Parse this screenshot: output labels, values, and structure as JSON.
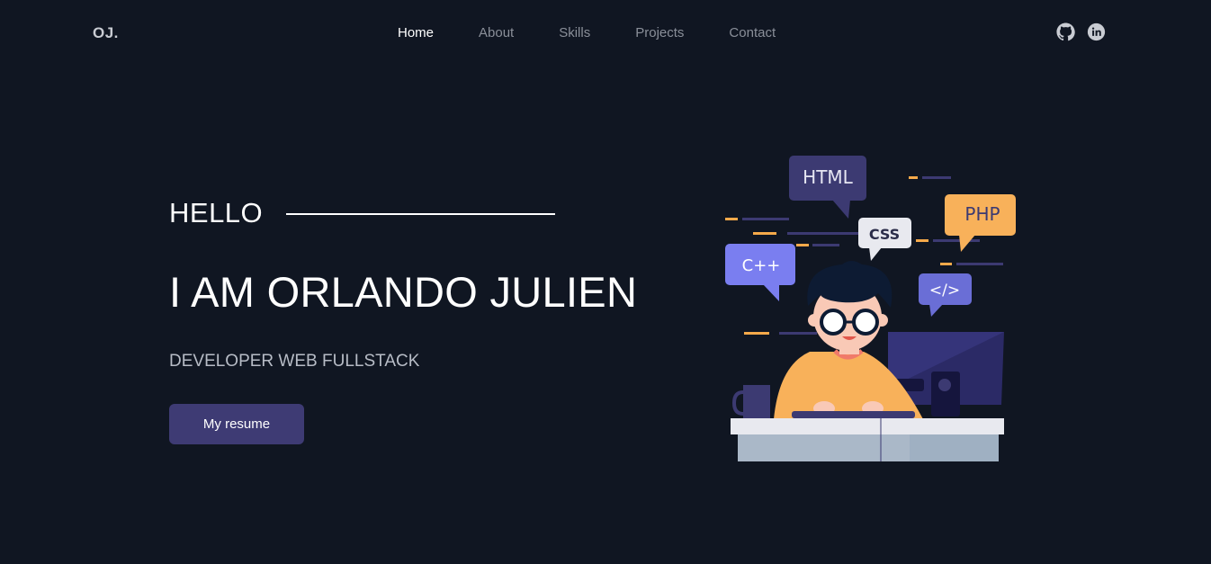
{
  "nav": {
    "logo": "OJ.",
    "items": [
      {
        "label": "Home",
        "active": true
      },
      {
        "label": "About",
        "active": false
      },
      {
        "label": "Skills",
        "active": false
      },
      {
        "label": "Projects",
        "active": false
      },
      {
        "label": "Contact",
        "active": false
      }
    ],
    "socials": [
      {
        "icon": "github-icon"
      },
      {
        "icon": "linkedin-icon"
      }
    ]
  },
  "hero": {
    "greeting": "HELLO",
    "name": "I AM ORLANDO JULIEN",
    "role": "DEVELOPER WEB FULLSTACK",
    "button_label": "My resume"
  },
  "illustration": {
    "bubbles": {
      "html": "HTML",
      "css": "CSS",
      "php": "PHP",
      "cpp": "C++",
      "code": "</>"
    }
  },
  "colors": {
    "background": "#101622",
    "accent": "#3e3b74",
    "text_muted": "#8a8f99"
  }
}
